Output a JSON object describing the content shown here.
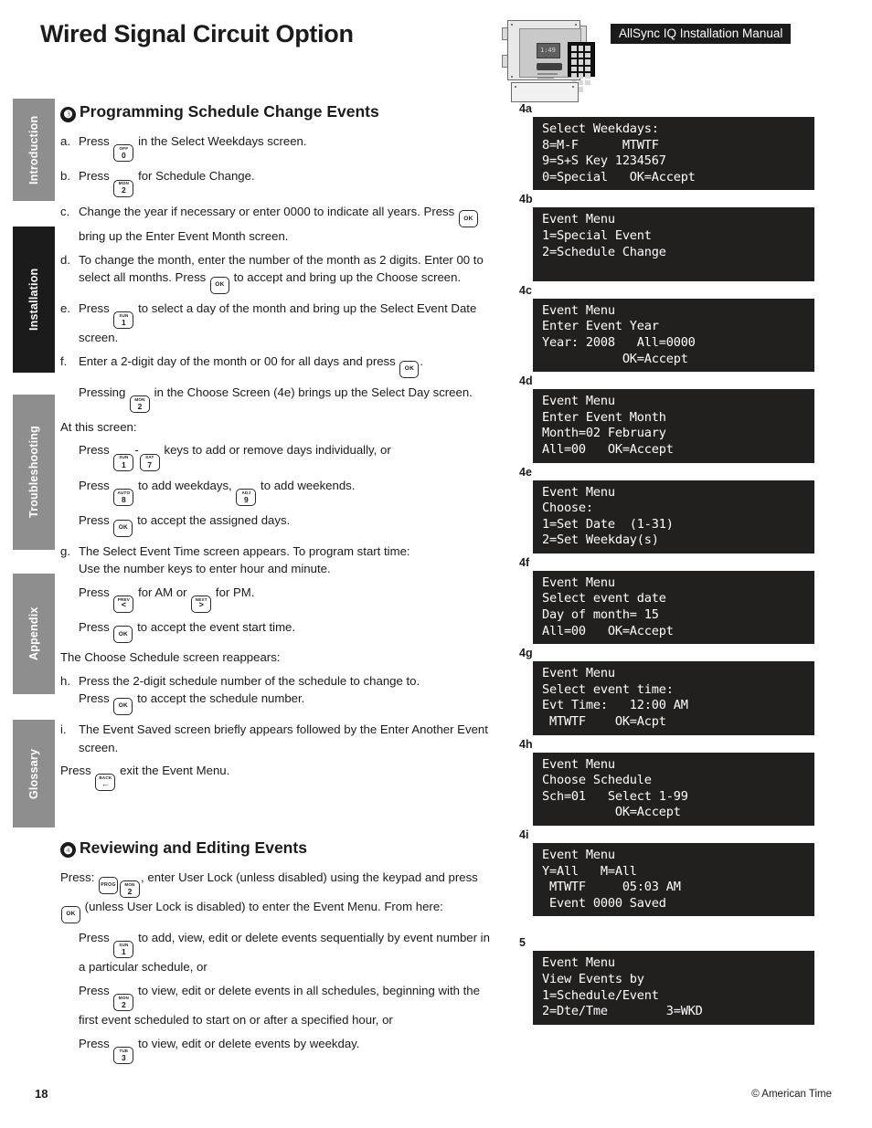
{
  "page_title": "Wired Signal Circuit Option",
  "manual_banner": "AllSync IQ Installation Manual",
  "device": {
    "lcd_text": "1:49"
  },
  "sidebar": {
    "items": [
      {
        "label": "Introduction",
        "active": false
      },
      {
        "label": "Installation",
        "active": true
      },
      {
        "label": "Troubleshooting",
        "active": false
      },
      {
        "label": "Appendix",
        "active": false
      },
      {
        "label": "Glossary",
        "active": false
      }
    ]
  },
  "section4": {
    "number": "❸",
    "title": "Programming Schedule Change Events",
    "a_mark": "a.",
    "a_pre": "Press",
    "a_key": {
      "top": "OFF",
      "bottom": "0"
    },
    "a_post": "in the Select Weekdays screen.",
    "b_mark": "b.",
    "b_pre": "Press",
    "b_key": {
      "top": "MON",
      "bottom": "2"
    },
    "b_post": "for Schedule Change.",
    "c_mark": "c.",
    "c_pre": "Change the year if necessary or enter 0000 to indicate all years. Press",
    "c_key": {
      "top": "",
      "bottom": "OK"
    },
    "c_post": "bring up the Enter Event Month screen.",
    "d_mark": "d.",
    "d_pre": "To change the month, enter the number of the month as 2 digits. Enter 00 to select all months. Press",
    "d_key": {
      "top": "",
      "bottom": "OK"
    },
    "d_post": "to accept and bring up the Choose screen.",
    "e_mark": "e.",
    "e_pre": "Press",
    "e_key": {
      "top": "SUN",
      "bottom": "1"
    },
    "e_post": "to select a day of the month and bring up the Select Event Date screen.",
    "f_mark": "f.",
    "f_pre": "Enter a 2-digit day of the month or 00 for all days and press",
    "f_key": {
      "top": "",
      "bottom": "OK"
    },
    "f_post": ".",
    "f2_pre": "Pressing",
    "f2_key": {
      "top": "MON",
      "bottom": "2"
    },
    "f2_post": "in the Choose Screen (4e) brings up the Select Day screen.",
    "at_screen": "At this screen:",
    "s1_pre": "Press",
    "s1_key_a": {
      "top": "SUN",
      "bottom": "1"
    },
    "s1_dash": "-",
    "s1_key_b": {
      "top": "SAT",
      "bottom": "7"
    },
    "s1_post": "keys to add or remove days individually, or",
    "s2_pre": "Press",
    "s2_key_a": {
      "top": "AUTO",
      "bottom": "8"
    },
    "s2_mid": "to add weekdays,",
    "s2_key_b": {
      "top": "ADJ",
      "bottom": "9"
    },
    "s2_post": "to add weekends.",
    "s3_pre": "Press",
    "s3_key": {
      "top": "",
      "bottom": "OK"
    },
    "s3_post": "to accept the assigned days.",
    "g_mark": "g.",
    "g_line1": "The Select Event Time screen appears. To program start time:",
    "g_line2": "Use the number keys to enter hour and minute.",
    "g1_pre": "Press",
    "g1_key_a": {
      "top": "PREV",
      "bottom": "<"
    },
    "g1_mid": "for AM or",
    "g1_key_b": {
      "top": "NEXT",
      "bottom": ">"
    },
    "g1_post": "for PM.",
    "g2_pre": "Press",
    "g2_key": {
      "top": "",
      "bottom": "OK"
    },
    "g2_post": "to accept the event start time.",
    "choose_reappears": "The Choose Schedule screen reappears:",
    "h_mark": "h.",
    "h_line1": "Press the 2-digit schedule number of the schedule to change to.",
    "h_pre": "Press",
    "h_key": {
      "top": "",
      "bottom": "OK"
    },
    "h_post": "to accept the schedule number.",
    "i_mark": "i.",
    "i_text": "The Event Saved screen briefly appears followed by the Enter Another Event screen.",
    "exit_pre": "Press",
    "exit_key": {
      "top": "BACK",
      "bottom": "←"
    },
    "exit_post": "exit the Event Menu."
  },
  "section5": {
    "number": "❹",
    "title": "Reviewing and Editing Events",
    "p1_pre": "Press:",
    "p1_key_a": {
      "top": "PROG",
      "bottom": ""
    },
    "p1_key_b": {
      "top": "MON",
      "bottom": "2"
    },
    "p1_mid": ", enter User Lock (unless disabled) using the keypad and press",
    "p1_key_c": {
      "top": "",
      "bottom": "OK"
    },
    "p1_post": "(unless User Lock is disabled) to enter the Event Menu. From here:",
    "r1_pre": "Press",
    "r1_key": {
      "top": "SUN",
      "bottom": "1"
    },
    "r1_post": "to add, view, edit or delete events sequentially by event number in a particular schedule, or",
    "r2_pre": "Press",
    "r2_key": {
      "top": "MON",
      "bottom": "2"
    },
    "r2_post": "to view, edit or delete events in all schedules, beginning with the first event scheduled to start on or after a specified hour, or",
    "r3_pre": "Press",
    "r3_key": {
      "top": "TUE",
      "bottom": "3"
    },
    "r3_post": "to view, edit or delete events by weekday."
  },
  "lcd_screens": [
    {
      "label": "4a",
      "lines": [
        "Select Weekdays:",
        "8=M-F      MTWTF",
        "9=S+S Key 1234567",
        "0=Special   OK=Accept"
      ]
    },
    {
      "label": "4b",
      "lines": [
        "Event Menu",
        "1=Special Event",
        "2=Schedule Change",
        ""
      ]
    },
    {
      "label": "4c",
      "lines": [
        "Event Menu",
        "Enter Event Year",
        "Year: 2008   All=0000",
        "           OK=Accept"
      ]
    },
    {
      "label": "4d",
      "lines": [
        "Event Menu",
        "Enter Event Month",
        "Month=02 February",
        "All=00   OK=Accept"
      ]
    },
    {
      "label": "4e",
      "lines": [
        "Event Menu",
        "Choose:",
        "1=Set Date  (1-31)",
        "2=Set Weekday(s)"
      ]
    },
    {
      "label": "4f",
      "lines": [
        "Event Menu",
        "Select event date",
        "Day of month= 15",
        "All=00   OK=Accept"
      ]
    },
    {
      "label": "4g",
      "lines": [
        "Event Menu",
        "Select event time:",
        "Evt Time:   12:00 AM",
        " MTWTF    OK=Acpt"
      ]
    },
    {
      "label": "4h",
      "lines": [
        "Event Menu",
        "Choose Schedule",
        "Sch=01   Select 1-99",
        "          OK=Accept"
      ]
    },
    {
      "label": "4i",
      "lines": [
        "Event Menu",
        "Y=All   M=All",
        " MTWTF     05:03 AM",
        " Event 0000 Saved"
      ]
    },
    {
      "label": "5",
      "lines": [
        "Event Menu",
        "View Events by",
        "1=Schedule/Event",
        "2=Dte/Tme        3=WKD"
      ]
    }
  ],
  "footer": {
    "page_number": "18",
    "copyright": "© American Time"
  }
}
